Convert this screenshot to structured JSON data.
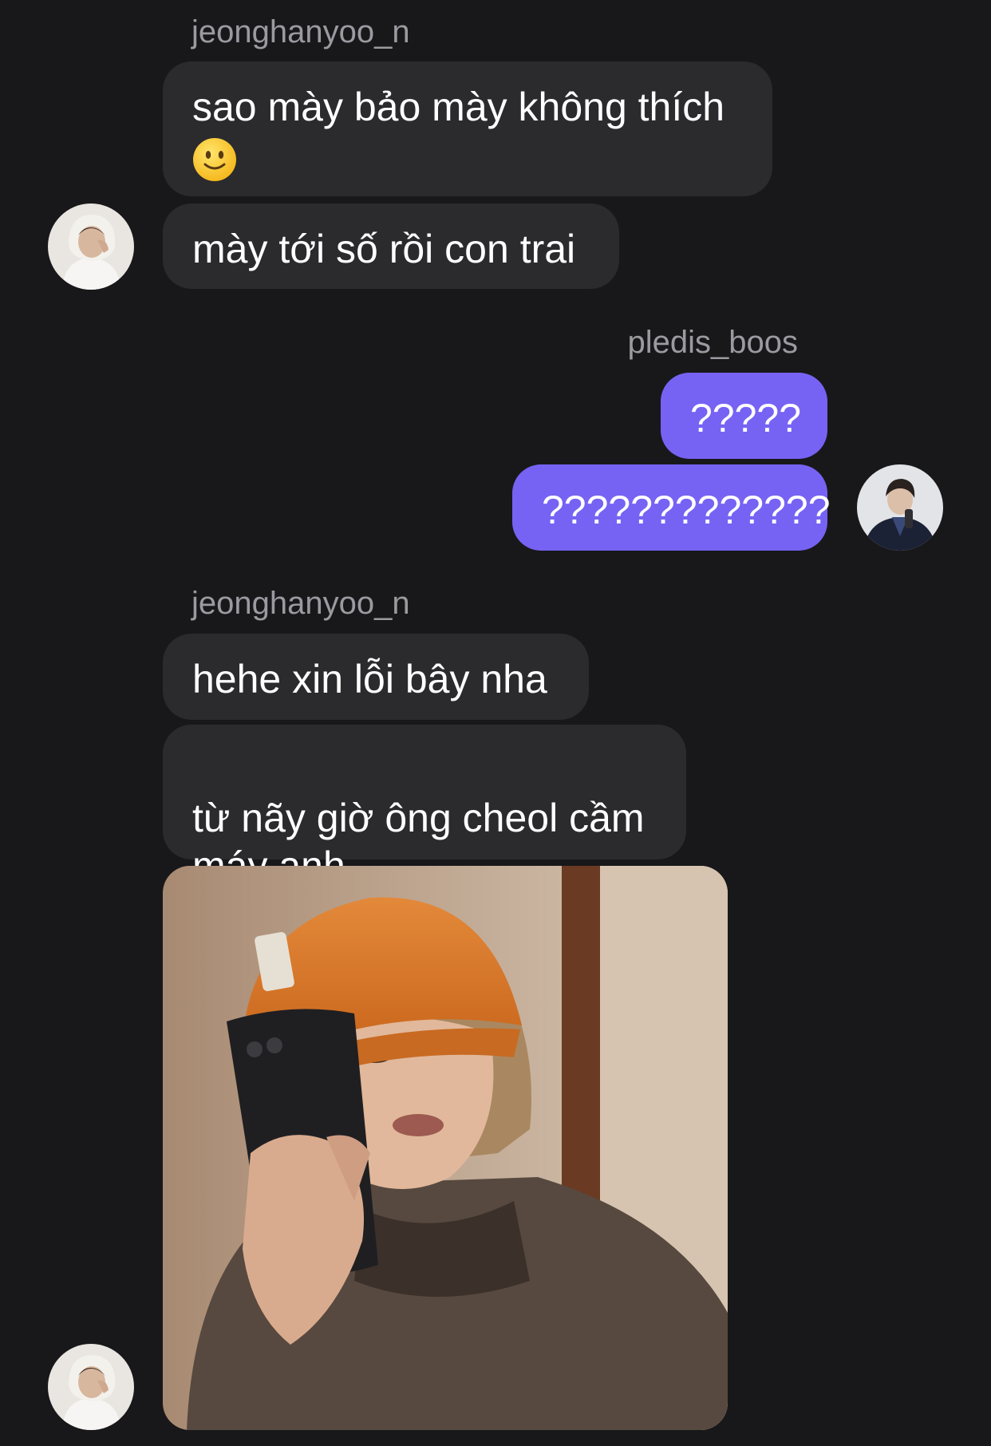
{
  "conversation": {
    "groups": [
      {
        "sender": "jeonghanyoo_n",
        "messages": [
          {
            "text": "sao mày bảo mày không thích",
            "emoji": "slightly-smiling-face"
          },
          {
            "text": "mày tới số rồi con trai"
          }
        ]
      },
      {
        "sender": "pledis_boos",
        "messages": [
          {
            "text": "?????"
          },
          {
            "text": "?????????????"
          }
        ]
      },
      {
        "sender": "jeonghanyoo_n",
        "messages": [
          {
            "text": "hehe xin lỗi bây nha"
          },
          {
            "text": "từ nãy giờ ông cheol cầm\nmáy anh"
          },
          {
            "image": "photo-person-orange-beanie-phone-selfie"
          }
        ]
      }
    ]
  },
  "colors": {
    "background": "#18181b",
    "incoming_bubble": "#2b2b2e",
    "outgoing_bubble": "#7663f4",
    "sender_name": "#9a9aa0",
    "text": "#ffffff"
  },
  "icons": {
    "incoming_avatar": "avatar-white-hood",
    "outgoing_avatar": "avatar-dark-jacket"
  }
}
